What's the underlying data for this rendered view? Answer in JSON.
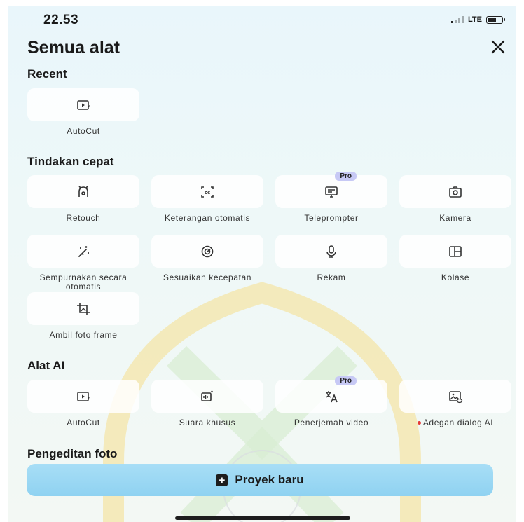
{
  "status_bar": {
    "time": "22.53",
    "network": "LTE",
    "battery_level": 0.55
  },
  "header": {
    "title": "Semua alat",
    "close_icon": "close-icon"
  },
  "sections": {
    "recent": {
      "title": "Recent",
      "items": [
        {
          "label": "AutoCut",
          "icon": "autocut-icon"
        }
      ]
    },
    "quick": {
      "title": "Tindakan cepat",
      "items": [
        {
          "label": "Retouch",
          "icon": "retouch-icon"
        },
        {
          "label": "Keterangan otomatis",
          "icon": "captions-icon"
        },
        {
          "label": "Teleprompter",
          "icon": "teleprompter-icon",
          "badge": "Pro"
        },
        {
          "label": "Kamera",
          "icon": "camera-icon"
        },
        {
          "label": "Sempurnakan secara otomatis",
          "icon": "magic-wand-icon"
        },
        {
          "label": "Sesuaikan kecepatan",
          "icon": "speed-icon"
        },
        {
          "label": "Rekam",
          "icon": "microphone-icon"
        },
        {
          "label": "Kolase",
          "icon": "collage-icon"
        },
        {
          "label": "Ambil foto frame",
          "icon": "crop-frame-icon"
        }
      ]
    },
    "ai": {
      "title": "Alat AI",
      "items": [
        {
          "label": "AutoCut",
          "icon": "autocut-icon"
        },
        {
          "label": "Suara khusus",
          "icon": "voice-icon"
        },
        {
          "label": "Penerjemah video",
          "icon": "translate-icon",
          "badge": "Pro"
        },
        {
          "label": "Adegan dialog AI",
          "icon": "dialog-scene-icon",
          "new_dot": true
        }
      ]
    },
    "photo": {
      "title": "Pengeditan foto"
    }
  },
  "cta": {
    "label": "Proyek baru",
    "icon": "plus-icon"
  },
  "colors": {
    "cta_bg": "#9fd9f4",
    "pro_badge": "#c7c9f5",
    "new_dot": "#e53935"
  }
}
